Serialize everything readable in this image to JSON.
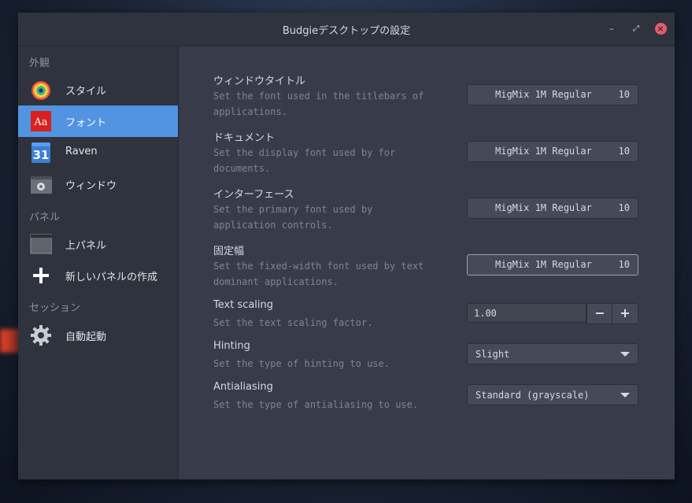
{
  "window": {
    "title": "Budgieデスクトップの設定"
  },
  "colors": {
    "accent": "#5294e2",
    "window_bg": "#383c4a",
    "sidebar_bg": "#2f333d",
    "close": "#e25d6c"
  },
  "sidebar": {
    "sections": [
      {
        "header": "外観",
        "items": [
          {
            "label": "スタイル",
            "icon": "rainbow-style-icon"
          },
          {
            "label": "フォント",
            "icon": "font-icon",
            "selected": true
          },
          {
            "label": "Raven",
            "icon": "calendar-icon"
          },
          {
            "label": "ウィンドウ",
            "icon": "window-settings-icon"
          }
        ]
      },
      {
        "header": "パネル",
        "items": [
          {
            "label": "上パネル",
            "icon": "panel-icon"
          },
          {
            "label": "新しいパネルの作成",
            "icon": "plus-icon"
          }
        ]
      },
      {
        "header": "セッション",
        "items": [
          {
            "label": "自動起動",
            "icon": "gear-icon"
          }
        ]
      }
    ]
  },
  "settings": {
    "window_title": {
      "name": "ウィンドウタイトル",
      "desc": "Set the font used in the titlebars of applications.",
      "font": "MigMix 1M Regular",
      "size": "10"
    },
    "document": {
      "name": "ドキュメント",
      "desc": "Set the display font used by for documents.",
      "font": "MigMix 1M Regular",
      "size": "10"
    },
    "interface": {
      "name": "インターフェース",
      "desc": "Set the primary font used by application controls.",
      "font": "MigMix 1M Regular",
      "size": "10"
    },
    "monospace": {
      "name": "固定幅",
      "desc": "Set the fixed-width font used by text dominant applications.",
      "font": "MigMix 1M Regular",
      "size": "10"
    },
    "text_scaling": {
      "name": "Text scaling",
      "desc": "Set the text scaling factor.",
      "value": "1.00",
      "minus": "−",
      "plus": "+"
    },
    "hinting": {
      "name": "Hinting",
      "desc": "Set the type of hinting to use.",
      "value": "Slight"
    },
    "antialiasing": {
      "name": "Antialiasing",
      "desc": "Set the type of antialiasing to use.",
      "value": "Standard (grayscale)"
    }
  }
}
